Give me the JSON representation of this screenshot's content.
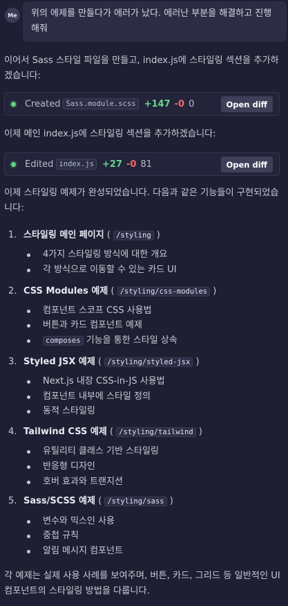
{
  "user": {
    "avatar": "Me",
    "message": "위의 에제를 만들다가 에러가 났다. 에러난 부분을 해결하고 진행해줘"
  },
  "para1": "이어서 Sass 스타일 파일을 만들고, index.js에 스타일링 섹션을 추가하겠습니다:",
  "file1": {
    "status": "Created",
    "filename": "Sass.module.scss",
    "added": "+147",
    "removed": "-0",
    "count": "0",
    "button": "Open diff"
  },
  "para2": "이제 메인 index.js에 스타일링 섹션을 추가하겠습니다:",
  "file2": {
    "status": "Edited",
    "filename": "index.js",
    "added": "+27",
    "removed": "-0",
    "count": "81",
    "button": "Open diff"
  },
  "para3": "이제 스타일링 예제가 완성되었습니다. 다음과 같은 기능들이 구현되었습니다:",
  "sections": [
    {
      "num": "1.",
      "title": "스타일링 메인 페이지",
      "path": "/styling",
      "items": [
        "4가지 스타일링 방식에 대한 개요",
        "각 방식으로 이동할 수 있는 카드 UI"
      ]
    },
    {
      "num": "2.",
      "title": "CSS Modules 예제",
      "path": "/styling/css-modules",
      "items": [
        "컴포넌트 스코프 CSS 사용법",
        "버튼과 카드 컴포넌트 예제"
      ],
      "extra_code": "composes",
      "extra_text": "기능을 통한 스타일 상속"
    },
    {
      "num": "3.",
      "title": "Styled JSX 예제",
      "path": "/styling/styled-jsx",
      "items": [
        "Next.js 내장 CSS-in-JS 사용법",
        "컴포넌트 내부에 스타일 정의",
        "동적 스타일링"
      ]
    },
    {
      "num": "4.",
      "title": "Tailwind CSS 예제",
      "path": "/styling/tailwind",
      "items": [
        "유틸리티 클래스 기반 스타일링",
        "반응형 디자인",
        "호버 효과와 트랜지션"
      ]
    },
    {
      "num": "5.",
      "title": "Sass/SCSS 예제",
      "path": "/styling/sass",
      "items": [
        "변수와 믹스인 사용",
        "중첩 규칙",
        "알림 메시지 컴포넌트"
      ]
    }
  ],
  "para4": "각 예제는 실제 사용 사례를 보여주며, 버튼, 카드, 그리드 등 일반적인 UI 컴포넌트의 스타일링 방법을 다룹니다."
}
